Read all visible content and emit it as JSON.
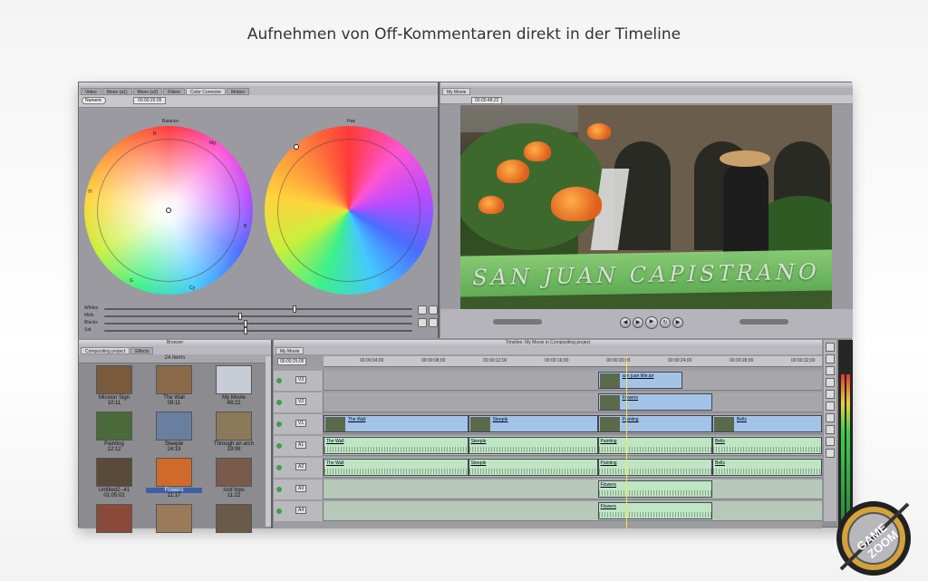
{
  "headline": "Aufnehmen von Off-Kommentaren direkt in der Timeline",
  "color_corrector": {
    "tabs": [
      "Video",
      "Mono (a1)",
      "Mono (a2)",
      "Filters",
      "Color Corrector",
      "Motion"
    ],
    "mode_button": "Numeric",
    "timecode": "00:00:25:05",
    "balance_label": "Balance",
    "hue_label": "Hue",
    "balance_marks": [
      "R",
      "Mg",
      "B",
      "Cy",
      "G",
      "Yl"
    ],
    "sliders": [
      "Whites",
      "Mids",
      "Blacks",
      "Sat"
    ]
  },
  "viewer": {
    "tab": "My Movie",
    "timecode": "00:00:48;22",
    "title_overlay": "SAN JUAN CAPISTRANO"
  },
  "browser": {
    "tabs": [
      "Compositing project",
      "Effects"
    ],
    "window_title": "Browser",
    "items_count": "24 items",
    "items": [
      {
        "name": "Mission Sign",
        "duration": "10:11",
        "color": "#7a5a3c"
      },
      {
        "name": "The Wall",
        "duration": "09:11",
        "color": "#8a6a4a"
      },
      {
        "name": "My Movie",
        "duration": "48:22",
        "color": "#c8ccd6"
      },
      {
        "name": "Painting",
        "duration": "12:12",
        "color": "#4a6a3a"
      },
      {
        "name": "Steeple",
        "duration": "24:19",
        "color": "#6a7ea0"
      },
      {
        "name": "Through an arch",
        "duration": "19:08",
        "color": "#8a7a5a"
      },
      {
        "name": "Untitled2--41",
        "duration": "01:05:02",
        "color": "#5a4a3a"
      },
      {
        "name": "Flowers",
        "duration": "11:17",
        "color": "#d06a2a"
      },
      {
        "name": "roof tops",
        "duration": "11:22",
        "color": "#7a5a4a"
      },
      {
        "name": "",
        "duration": "",
        "color": "#8a4a3a"
      },
      {
        "name": "",
        "duration": "",
        "color": "#9a7a5a"
      },
      {
        "name": "",
        "duration": "",
        "color": "#6a5a4a"
      }
    ],
    "selected_index": 7
  },
  "timeline": {
    "window_title": "Timeline: My Movie in Compositing project",
    "sequence_tab": "My Movie",
    "timecode": "00:00:25;05",
    "ruler_marks": [
      "00:00:04;00",
      "00:00:08;00",
      "00:00:12;00",
      "00:00:16;00",
      "00:00:20;00",
      "00:00:24;00",
      "00:00:28;00",
      "00:00:32;00"
    ],
    "tracks": [
      {
        "label": "V3",
        "kind": "video",
        "clips": [
          {
            "name": "san juan title.ipr",
            "start": 0.55,
            "end": 0.72
          }
        ]
      },
      {
        "label": "V2",
        "kind": "video",
        "clips": [
          {
            "name": "Flowers",
            "start": 0.55,
            "end": 0.78
          }
        ]
      },
      {
        "label": "V1",
        "kind": "video",
        "clips": [
          {
            "name": "The Wall",
            "start": 0.0,
            "end": 0.29
          },
          {
            "name": "Steeple",
            "start": 0.29,
            "end": 0.55
          },
          {
            "name": "Painting",
            "start": 0.55,
            "end": 0.78
          },
          {
            "name": "Bells",
            "start": 0.78,
            "end": 1.0
          }
        ]
      },
      {
        "label": "A1",
        "kind": "audio",
        "clips": [
          {
            "name": "The Wall",
            "start": 0.0,
            "end": 0.29
          },
          {
            "name": "Steeple",
            "start": 0.29,
            "end": 0.55
          },
          {
            "name": "Painting",
            "start": 0.55,
            "end": 0.78
          },
          {
            "name": "Bells",
            "start": 0.78,
            "end": 1.0
          }
        ]
      },
      {
        "label": "A2",
        "kind": "audio",
        "clips": [
          {
            "name": "The Wall",
            "start": 0.0,
            "end": 0.29
          },
          {
            "name": "Steeple",
            "start": 0.29,
            "end": 0.55
          },
          {
            "name": "Painting",
            "start": 0.55,
            "end": 0.78
          },
          {
            "name": "Bells",
            "start": 0.78,
            "end": 1.0
          }
        ]
      },
      {
        "label": "A3",
        "kind": "audio",
        "clips": [
          {
            "name": "Flowers",
            "start": 0.55,
            "end": 0.78
          }
        ]
      },
      {
        "label": "A4",
        "kind": "audio",
        "clips": [
          {
            "name": "Flowers",
            "start": 0.55,
            "end": 0.78
          }
        ]
      }
    ]
  },
  "watermark": {
    "line1": "GAME",
    "line2": "ZOOM"
  }
}
